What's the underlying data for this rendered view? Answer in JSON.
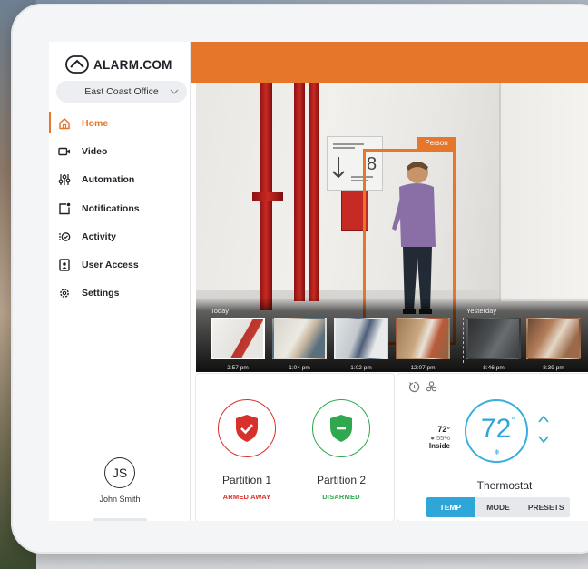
{
  "brand": {
    "name": "ALARM.COM",
    "accent": "#e5762a",
    "blue": "#2ea7d8"
  },
  "site_selector": {
    "value": "East Coast Office"
  },
  "nav": {
    "items": [
      {
        "label": "Home",
        "icon": "home-icon",
        "active": true
      },
      {
        "label": "Video",
        "icon": "video-camera-icon",
        "active": false
      },
      {
        "label": "Automation",
        "icon": "automation-sliders-icon",
        "active": false
      },
      {
        "label": "Notifications",
        "icon": "notification-bell-icon",
        "active": false
      },
      {
        "label": "Activity",
        "icon": "activity-list-icon",
        "active": false
      },
      {
        "label": "User Access",
        "icon": "user-badge-icon",
        "active": false
      },
      {
        "label": "Settings",
        "icon": "gear-icon",
        "active": false
      }
    ]
  },
  "user": {
    "initials": "JS",
    "name": "John Smith"
  },
  "camera": {
    "detection_label": "Person",
    "sign_number": "8",
    "timeline": {
      "today_label": "Today",
      "yesterday_label": "Yesterday",
      "clips": [
        {
          "time": "2:57 pm",
          "day": "today",
          "selected": true
        },
        {
          "time": "1:04 pm",
          "day": "today",
          "selected": false
        },
        {
          "time": "1:02 pm",
          "day": "today",
          "selected": false
        },
        {
          "time": "12:07 pm",
          "day": "today",
          "selected": false
        },
        {
          "time": "8:46 pm",
          "day": "yesterday",
          "selected": false
        },
        {
          "time": "8:39 pm",
          "day": "yesterday",
          "selected": false
        }
      ]
    }
  },
  "security": {
    "partitions": [
      {
        "name": "Partition 1",
        "status": "ARMED AWAY",
        "color": "#d9302b"
      },
      {
        "name": "Partition 2",
        "status": "DISARMED",
        "color": "#2fa84f"
      }
    ]
  },
  "thermostat": {
    "title": "Thermostat",
    "setpoint": "72",
    "degree": "°",
    "inside_temp": "72°",
    "inside_humidity": "55%",
    "inside_label": "Inside",
    "tabs": [
      {
        "label": "TEMP",
        "active": true
      },
      {
        "label": "MODE",
        "active": false
      },
      {
        "label": "PRESETS",
        "active": false
      }
    ]
  }
}
